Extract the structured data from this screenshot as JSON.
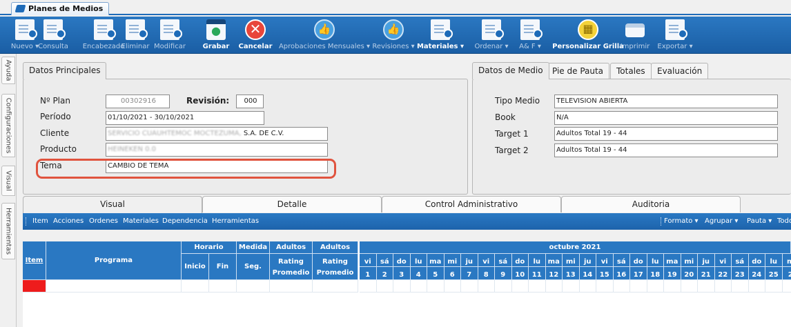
{
  "window": {
    "tab_title": "Planes de Medios"
  },
  "toolbar": [
    {
      "label": "Nuevo ▾",
      "icon": "new-doc-icon",
      "active": false
    },
    {
      "label": "Consulta",
      "icon": "query-doc-icon",
      "active": false
    },
    {
      "label": "Encabezado",
      "icon": "edit-header-icon",
      "active": false
    },
    {
      "label": "Eliminar",
      "icon": "delete-doc-icon",
      "active": false
    },
    {
      "label": "Modificar",
      "icon": "modify-doc-icon",
      "active": false
    },
    {
      "label": "Grabar",
      "icon": "save-icon",
      "active": true
    },
    {
      "label": "Cancelar",
      "icon": "cancel-icon",
      "active": true
    },
    {
      "label": "Aprobaciones Mensuales ▾",
      "icon": "thumbs-up-icon",
      "active": false
    },
    {
      "label": "Revisiones ▾",
      "icon": "thumbs-up-icon",
      "active": false
    },
    {
      "label": "Materiales ▾",
      "icon": "materials-icon",
      "active": true
    },
    {
      "label": "Ordenar ▾",
      "icon": "order-doc-icon",
      "active": false
    },
    {
      "label": "A& F ▾",
      "icon": "af-doc-icon",
      "active": false
    },
    {
      "label": "Personalizar Grilla",
      "icon": "grid-icon",
      "active": true
    },
    {
      "label": "Imprimir",
      "icon": "printer-icon",
      "active": false
    },
    {
      "label": "Exportar ▾",
      "icon": "export-icon",
      "active": false
    }
  ],
  "side_tabs": [
    "Ayuda",
    "Configuraciones",
    "Visual",
    "Herramientas"
  ],
  "principal": {
    "tab": "Datos Principales",
    "plan_label": "Nº Plan",
    "plan_value": "00302916",
    "revision_label": "Revisión:",
    "revision_value": "000",
    "periodo_label": "Período",
    "periodo_value": "01/10/2021 - 30/10/2021",
    "cliente_label": "Cliente",
    "cliente_blurred": "SERVICIO CUAUHTEMOC MOCTEZUMA,",
    "cliente_value": " S.A. DE C.V.",
    "producto_label": "Producto",
    "producto_blurred": "HEINEKEN 0.0",
    "tema_label": "Tema",
    "tema_value": "CAMBIO DE TEMA"
  },
  "medio": {
    "tabs": [
      "Datos de Medio",
      "Pie de Pauta",
      "Totales",
      "Evaluación"
    ],
    "tipo_label": "Tipo Medio",
    "tipo_value": "TELEVISION ABIERTA",
    "book_label": "Book",
    "book_value": "N/A",
    "target1_label": "Target 1",
    "target1_value": "Adultos Total  19 - 44",
    "target2_label": "Target 2",
    "target2_value": "Adultos Total  19 - 44"
  },
  "bottom_tabs": [
    "Visual",
    "Detalle",
    "Control Administrativo",
    "Auditoria"
  ],
  "menu_left": [
    "Item",
    "Acciones",
    "Ordenes",
    "Materiales",
    "Dependencia",
    "Herramientas"
  ],
  "menu_right": [
    "Formato ▾",
    "Agrupar ▾",
    "Pauta ▾",
    "Todo"
  ],
  "grid": {
    "item": "Item",
    "programa": "Programa",
    "horario": "Horario",
    "inicio": "Inicio",
    "fin": "Fin",
    "medida": "Medida",
    "seg": "Seg.",
    "adultos1": "Adultos",
    "rating1": "Rating Promedio",
    "adultos2": "Adultos",
    "rating2": "Rating Promedio",
    "month": "octubre 2021",
    "days": [
      "vi",
      "sá",
      "do",
      "lu",
      "ma",
      "mi",
      "ju",
      "vi",
      "sá",
      "do",
      "lu",
      "ma",
      "mi",
      "ju",
      "vi",
      "sá",
      "do",
      "lu",
      "ma",
      "mi",
      "ju",
      "vi",
      "sá",
      "do",
      "lu",
      "m"
    ],
    "dates": [
      "1",
      "2",
      "3",
      "4",
      "5",
      "6",
      "7",
      "8",
      "9",
      "10",
      "11",
      "12",
      "13",
      "14",
      "15",
      "16",
      "17",
      "18",
      "19",
      "20",
      "21",
      "22",
      "23",
      "24",
      "25",
      "2"
    ]
  }
}
